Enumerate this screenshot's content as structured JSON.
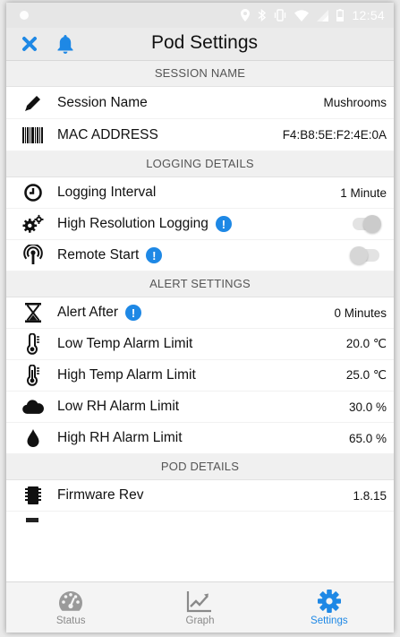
{
  "status_bar": {
    "time": "12:54"
  },
  "header": {
    "title": "Pod Settings"
  },
  "sections": {
    "session_name": "SESSION NAME",
    "logging_details": "LOGGING DETAILS",
    "alert_settings": "ALERT SETTINGS",
    "pod_details": "POD DETAILS"
  },
  "rows": {
    "session_name": {
      "label": "Session Name",
      "value": "Mushrooms"
    },
    "mac_address": {
      "label": "MAC ADDRESS",
      "value": "F4:B8:5E:F2:4E:0A"
    },
    "logging_interval": {
      "label": "Logging Interval",
      "value": "1 Minute"
    },
    "high_res_logging": {
      "label": "High Resolution Logging",
      "enabled": true
    },
    "remote_start": {
      "label": "Remote Start",
      "enabled": false
    },
    "alert_after": {
      "label": "Alert After",
      "value": "0 Minutes"
    },
    "low_temp": {
      "label": "Low Temp Alarm Limit",
      "value": "20.0 ℃"
    },
    "high_temp": {
      "label": "High Temp Alarm Limit",
      "value": "25.0 ℃"
    },
    "low_rh": {
      "label": "Low RH Alarm Limit",
      "value": "30.0 %"
    },
    "high_rh": {
      "label": "High RH Alarm Limit",
      "value": "65.0 %"
    },
    "firmware": {
      "label": "Firmware Rev",
      "value": "1.8.15"
    }
  },
  "info_glyph": "!",
  "tabs": [
    {
      "label": "Status",
      "icon": "gauge-icon"
    },
    {
      "label": "Graph",
      "icon": "chart-icon"
    },
    {
      "label": "Settings",
      "icon": "gear-icon",
      "active": true
    }
  ],
  "colors": {
    "accent": "#1e88e5",
    "header_bg": "#ebebeb",
    "section_bg": "#f0f0f0"
  }
}
